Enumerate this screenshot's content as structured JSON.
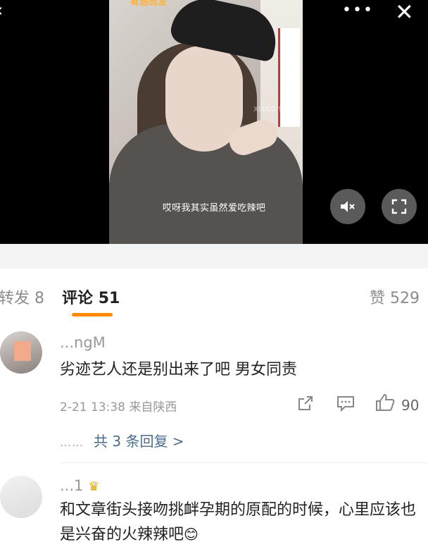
{
  "video": {
    "subtitle": "哎呀我其实虽然爱吃辣吧",
    "top_text": "有感而发",
    "watermark": "XIANG YAN",
    "icons": {
      "back": "back-icon",
      "more": "more-icon",
      "close": "close-icon",
      "mute": "mute-icon",
      "fullscreen": "fullscreen-icon"
    }
  },
  "tabs": {
    "repost_label": "转发",
    "repost_count": "8",
    "comment_label": "评论",
    "comment_count": "51",
    "like_label": "赞",
    "like_count": "529",
    "active_color": "#ff8a00"
  },
  "comments": [
    {
      "username": "...ngM",
      "text": "劣迹艺人还是别出来了吧 男女同责",
      "timestamp": "2-21 13:38",
      "location": "来自陕西",
      "likes": "90",
      "replies_label": "共 3 条回复 >",
      "icons": [
        "share-icon",
        "comment-icon",
        "like-icon"
      ]
    },
    {
      "username": "...1",
      "badge": "crown-icon",
      "text": "和文章街头接吻挑衅孕期的原配的时候，心里应该也是兴奋的火辣辣吧",
      "emoji": "😊"
    }
  ]
}
